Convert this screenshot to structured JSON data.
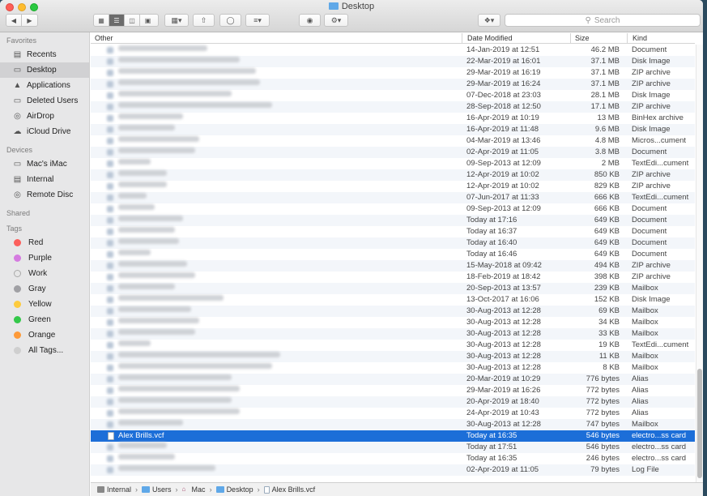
{
  "window": {
    "title": "Desktop"
  },
  "toolbar": {
    "back_icon": "chevron-left-icon",
    "forward_icon": "chevron-right-icon",
    "view_icons": [
      "icon-view-icon",
      "list-view-icon",
      "column-view-icon",
      "gallery-view-icon"
    ],
    "group_icon": "group-icon",
    "share_icon": "share-icon",
    "tag_icon": "tag-icon",
    "sort_icon": "sort-icon",
    "quicklook_icon": "eye-icon",
    "action_icon": "gear-icon",
    "dropbox_icon": "dropbox-icon",
    "search_placeholder": "Search"
  },
  "sidebar": {
    "favorites_header": "Favorites",
    "favorites": [
      {
        "label": "Recents",
        "icon": "recents-icon"
      },
      {
        "label": "Desktop",
        "icon": "desktop-icon",
        "selected": true
      },
      {
        "label": "Applications",
        "icon": "applications-icon"
      },
      {
        "label": "Deleted Users",
        "icon": "folder-icon"
      },
      {
        "label": "AirDrop",
        "icon": "airdrop-icon"
      },
      {
        "label": "iCloud Drive",
        "icon": "cloud-icon"
      }
    ],
    "devices_header": "Devices",
    "devices": [
      {
        "label": "Mac's iMac",
        "icon": "imac-icon"
      },
      {
        "label": "Internal",
        "icon": "disk-icon"
      },
      {
        "label": "Remote Disc",
        "icon": "disc-icon"
      }
    ],
    "shared_header": "Shared",
    "tags_header": "Tags",
    "tags": [
      {
        "label": "Red",
        "color": "#fc605c"
      },
      {
        "label": "Purple",
        "color": "#d57be0"
      },
      {
        "label": "Work",
        "color": "#e6e6e6"
      },
      {
        "label": "Gray",
        "color": "#a0a0a4"
      },
      {
        "label": "Yellow",
        "color": "#fdcb3e"
      },
      {
        "label": "Green",
        "color": "#34c84a"
      },
      {
        "label": "Orange",
        "color": "#fd9a39"
      },
      {
        "label": "All Tags...",
        "color": "#cfcfcf"
      }
    ]
  },
  "columns": {
    "name": "Other",
    "date": "Date Modified",
    "size": "Size",
    "kind": "Kind"
  },
  "files": [
    {
      "date": "14-Jan-2019 at 12:51",
      "size": "46.2 MB",
      "kind": "Document",
      "blur": 110
    },
    {
      "date": "22-Mar-2019 at 16:01",
      "size": "37.1 MB",
      "kind": "Disk Image",
      "blur": 150
    },
    {
      "date": "29-Mar-2019 at 16:19",
      "size": "37.1 MB",
      "kind": "ZIP archive",
      "blur": 170
    },
    {
      "date": "29-Mar-2019 at 16:24",
      "size": "37.1 MB",
      "kind": "ZIP archive",
      "blur": 175
    },
    {
      "date": "07-Dec-2018 at 23:03",
      "size": "28.1 MB",
      "kind": "Disk Image",
      "blur": 140
    },
    {
      "date": "28-Sep-2018 at 12:50",
      "size": "17.1 MB",
      "kind": "ZIP archive",
      "blur": 190
    },
    {
      "date": "16-Apr-2019 at 10:19",
      "size": "13 MB",
      "kind": "BinHex archive",
      "blur": 80
    },
    {
      "date": "16-Apr-2019 at 11:48",
      "size": "9.6 MB",
      "kind": "Disk Image",
      "blur": 70
    },
    {
      "date": "04-Mar-2019 at 13:46",
      "size": "4.8 MB",
      "kind": "Micros...cument",
      "blur": 100
    },
    {
      "date": "02-Apr-2019 at 11:05",
      "size": "3.8 MB",
      "kind": "Document",
      "blur": 95
    },
    {
      "date": "09-Sep-2013 at 12:09",
      "size": "2 MB",
      "kind": "TextEdi...cument",
      "blur": 40
    },
    {
      "date": "12-Apr-2019 at 10:02",
      "size": "850 KB",
      "kind": "ZIP archive",
      "blur": 60
    },
    {
      "date": "12-Apr-2019 at 10:02",
      "size": "829 KB",
      "kind": "ZIP archive",
      "blur": 60
    },
    {
      "date": "07-Jun-2017 at 11:33",
      "size": "666 KB",
      "kind": "TextEdi...cument",
      "blur": 35
    },
    {
      "date": "09-Sep-2013 at 12:09",
      "size": "666 KB",
      "kind": "Document",
      "blur": 45
    },
    {
      "date": "Today at 17:16",
      "size": "649 KB",
      "kind": "Document",
      "blur": 80
    },
    {
      "date": "Today at 16:37",
      "size": "649 KB",
      "kind": "Document",
      "blur": 70
    },
    {
      "date": "Today at 16:40",
      "size": "649 KB",
      "kind": "Document",
      "blur": 75
    },
    {
      "date": "Today at 16:46",
      "size": "649 KB",
      "kind": "Document",
      "blur": 40
    },
    {
      "date": "15-May-2018 at 09:42",
      "size": "494 KB",
      "kind": "ZIP archive",
      "blur": 85
    },
    {
      "date": "18-Feb-2019 at 18:42",
      "size": "398 KB",
      "kind": "ZIP archive",
      "blur": 95
    },
    {
      "date": "20-Sep-2013 at 13:57",
      "size": "239 KB",
      "kind": "Mailbox",
      "blur": 70
    },
    {
      "date": "13-Oct-2017 at 16:06",
      "size": "152 KB",
      "kind": "Disk Image",
      "blur": 130
    },
    {
      "date": "30-Aug-2013 at 12:28",
      "size": "69 KB",
      "kind": "Mailbox",
      "blur": 90
    },
    {
      "date": "30-Aug-2013 at 12:28",
      "size": "34 KB",
      "kind": "Mailbox",
      "blur": 100
    },
    {
      "date": "30-Aug-2013 at 12:28",
      "size": "33 KB",
      "kind": "Mailbox",
      "blur": 95
    },
    {
      "date": "30-Aug-2013 at 12:28",
      "size": "19 KB",
      "kind": "TextEdi...cument",
      "blur": 40
    },
    {
      "date": "30-Aug-2013 at 12:28",
      "size": "11 KB",
      "kind": "Mailbox",
      "blur": 200
    },
    {
      "date": "30-Aug-2013 at 12:28",
      "size": "8 KB",
      "kind": "Mailbox",
      "blur": 190
    },
    {
      "date": "20-Mar-2019 at 10:29",
      "size": "776 bytes",
      "kind": "Alias",
      "blur": 140
    },
    {
      "date": "29-Mar-2019 at 16:26",
      "size": "772 bytes",
      "kind": "Alias",
      "blur": 150
    },
    {
      "date": "20-Apr-2019 at 18:40",
      "size": "772 bytes",
      "kind": "Alias",
      "blur": 140
    },
    {
      "date": "24-Apr-2019 at 10:43",
      "size": "772 bytes",
      "kind": "Alias",
      "blur": 150
    },
    {
      "date": "30-Aug-2013 at 12:28",
      "size": "747 bytes",
      "kind": "Mailbox",
      "blur": 80
    },
    {
      "name": "Alex Brills.vcf",
      "date": "Today at 16:35",
      "size": "546 bytes",
      "kind": "electro...ss card",
      "selected": true
    },
    {
      "date": "Today at 17:51",
      "size": "546 bytes",
      "kind": "electro...ss card",
      "blur": 60
    },
    {
      "date": "Today at 16:35",
      "size": "246 bytes",
      "kind": "electro...ss card",
      "blur": 70
    },
    {
      "date": "02-Apr-2019 at 11:05",
      "size": "79 bytes",
      "kind": "Log File",
      "blur": 120
    }
  ],
  "pathbar": [
    {
      "label": "Internal",
      "icon": "disk-icon"
    },
    {
      "label": "Users",
      "icon": "folder-icon"
    },
    {
      "label": "Mac",
      "icon": "home-icon"
    },
    {
      "label": "Desktop",
      "icon": "folder-icon"
    },
    {
      "label": "Alex Brills.vcf",
      "icon": "vcf-file-icon"
    }
  ]
}
